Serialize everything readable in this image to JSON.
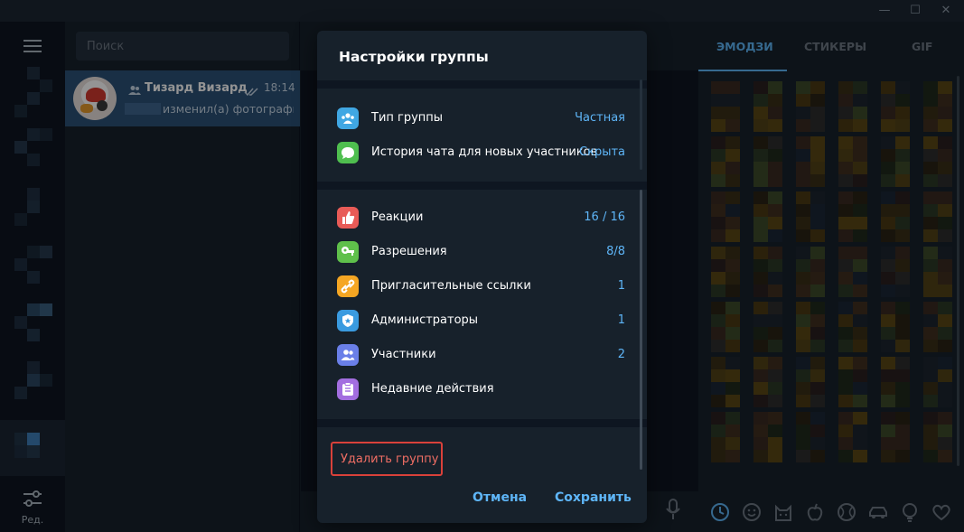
{
  "window": {
    "controls": {
      "minimize": "—",
      "maximize": "☐",
      "close": "✕"
    }
  },
  "sidebar": {
    "edit_label": "Ред."
  },
  "chatlist": {
    "search_placeholder": "Поиск",
    "chats": [
      {
        "name": "Тизард Визард",
        "time": "18:14",
        "preview": "изменил(а) фотографию группы",
        "read": true
      }
    ]
  },
  "emoji_panel": {
    "tabs": [
      "ЭМОДЗИ",
      "СТИКЕРЫ",
      "GIF"
    ],
    "active_tab": "ЭМОДЗИ",
    "categories": [
      "recent-icon",
      "smile-icon",
      "cat-icon",
      "apple-icon",
      "ball-icon",
      "car-icon",
      "bulb-icon",
      "heart-icon"
    ]
  },
  "modal": {
    "title": "Настройки группы",
    "section1": [
      {
        "icon": "group-type-icon",
        "label": "Тип группы",
        "value": "Частная",
        "color": "#40a7e3"
      },
      {
        "icon": "chat-history-icon",
        "label": "История чата для новых участников",
        "value": "Скрыта",
        "color": "#4fbf4f"
      }
    ],
    "section2": [
      {
        "icon": "reactions-icon",
        "label": "Реакции",
        "value": "16 / 16",
        "color": "#e85b57"
      },
      {
        "icon": "key-icon",
        "label": "Разрешения",
        "value": "8/8",
        "color": "#5fc04b"
      },
      {
        "icon": "link-icon",
        "label": "Пригласительные ссылки",
        "value": "1",
        "color": "#f5a623"
      },
      {
        "icon": "admin-shield-icon",
        "label": "Администраторы",
        "value": "1",
        "color": "#3a9be0"
      },
      {
        "icon": "members-icon",
        "label": "Участники",
        "value": "2",
        "color": "#6a7fe8"
      },
      {
        "icon": "recent-actions-icon",
        "label": "Недавние действия",
        "value": "",
        "color": "#a36ee0"
      }
    ],
    "delete_label": "Удалить группу",
    "cancel_label": "Отмена",
    "save_label": "Сохранить"
  },
  "colors": {
    "accent": "#5eb5f7",
    "danger": "#f06e64",
    "selected_chat": "#2b5278"
  }
}
